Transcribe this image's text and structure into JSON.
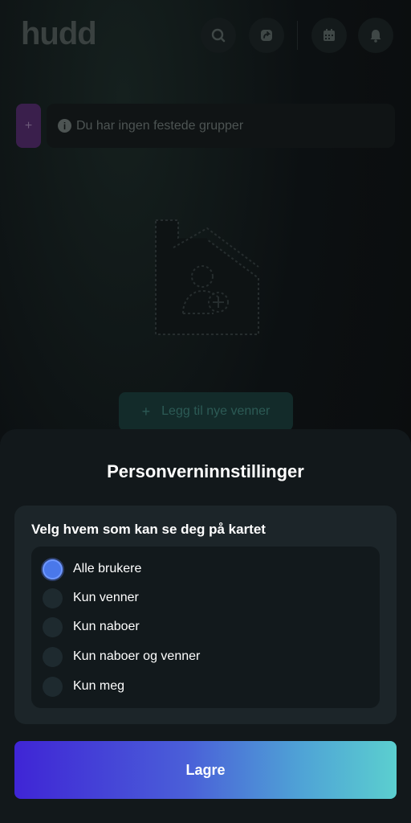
{
  "header": {
    "logo": "hudd",
    "icons": [
      "search-icon",
      "share-icon",
      "calendar-icon",
      "bell-icon"
    ]
  },
  "pinned": {
    "add_label": "+",
    "info_icon": "i",
    "empty_text": "Du har ingen festede grupper"
  },
  "empty_state": {
    "add_friends_plus": "+",
    "add_friends_label": "Legg til nye venner"
  },
  "sheet": {
    "title": "Personverninnstillinger",
    "question": "Velg hvem som kan se deg på kartet",
    "options": [
      {
        "label": "Alle brukere",
        "selected": true
      },
      {
        "label": "Kun venner",
        "selected": false
      },
      {
        "label": "Kun naboer",
        "selected": false
      },
      {
        "label": "Kun naboer og venner",
        "selected": false
      },
      {
        "label": "Kun meg",
        "selected": false
      }
    ],
    "save_label": "Lagre"
  },
  "colors": {
    "accent_selected": "#4a78ea",
    "gradient_start": "#3f25d6",
    "gradient_end": "#5bcfcf"
  }
}
